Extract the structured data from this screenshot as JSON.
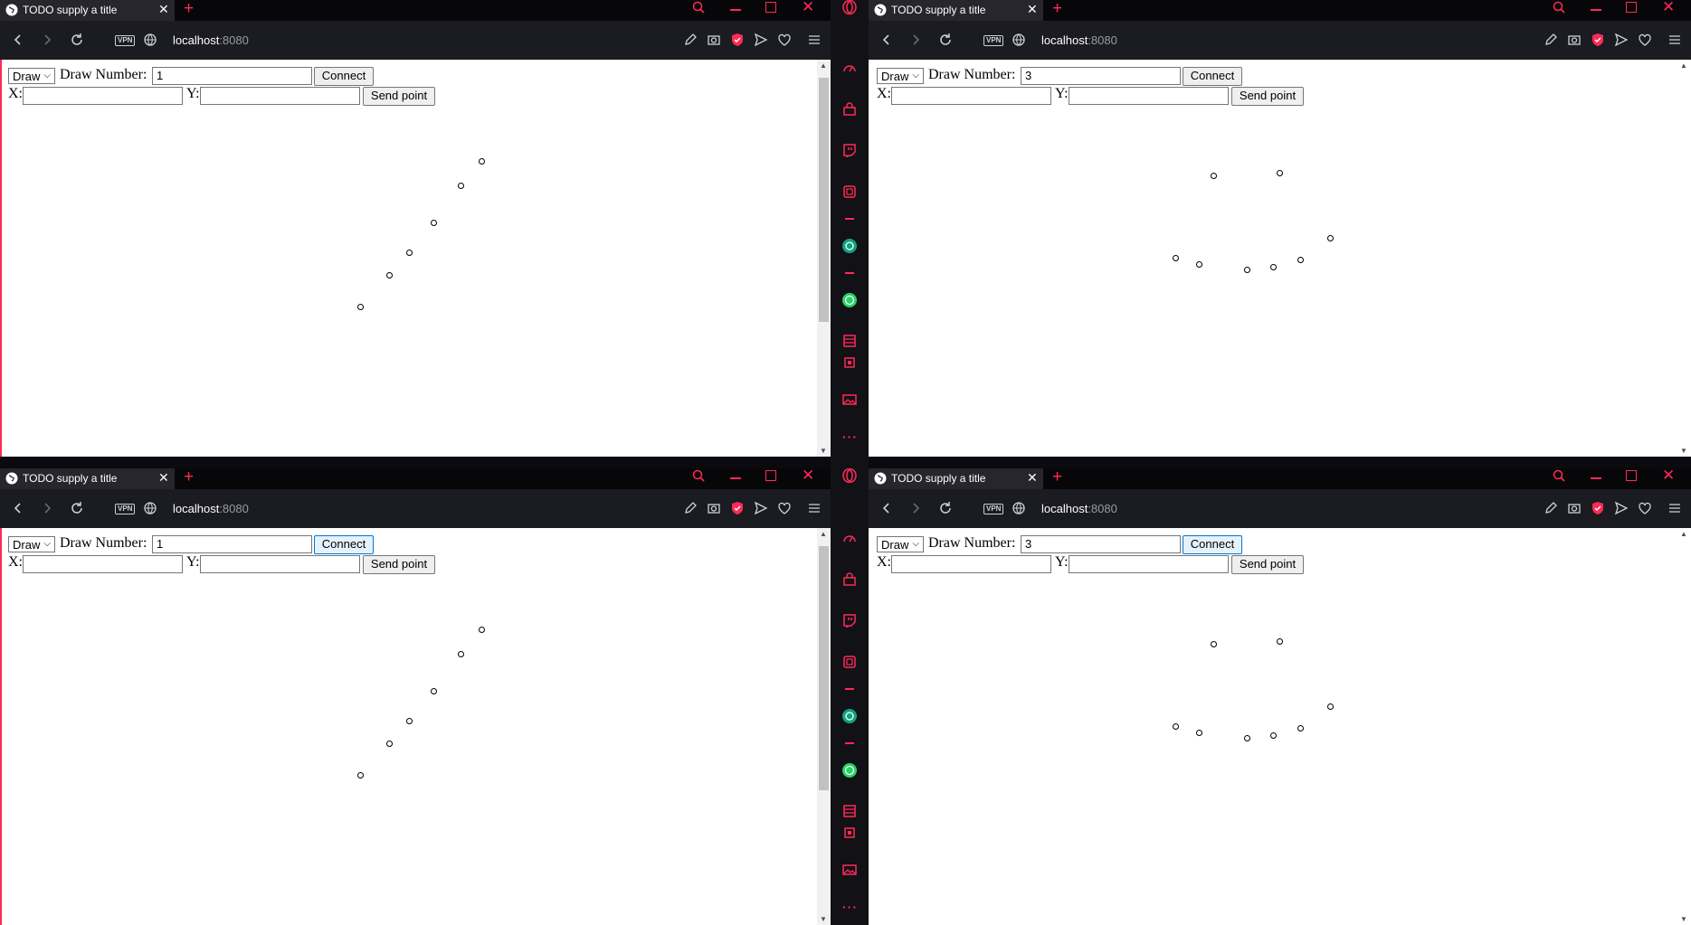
{
  "windows": [
    {
      "tab_title": "TODO supply a title",
      "url_host": "localhost",
      "url_port": ":8080",
      "mode_value": "Draw",
      "draw_number_label": "Draw Number:",
      "draw_number_value": "1",
      "connect_label": "Connect",
      "x_label": "X:",
      "y_label": "Y:",
      "send_label": "Send point",
      "connect_focused": false
    },
    {
      "tab_title": "TODO supply a title",
      "url_host": "localhost",
      "url_port": ":8080",
      "mode_value": "Draw",
      "draw_number_label": "Draw Number:",
      "draw_number_value": "3",
      "connect_label": "Connect",
      "x_label": "X:",
      "y_label": "Y:",
      "send_label": "Send point",
      "connect_focused": false
    },
    {
      "tab_title": "TODO supply a title",
      "url_host": "localhost",
      "url_port": ":8080",
      "mode_value": "Draw",
      "draw_number_label": "Draw Number:",
      "draw_number_value": "1",
      "connect_label": "Connect",
      "x_label": "X:",
      "y_label": "Y:",
      "send_label": "Send point",
      "connect_focused": true
    },
    {
      "tab_title": "TODO supply a title",
      "url_host": "localhost",
      "url_port": ":8080",
      "mode_value": "Draw",
      "draw_number_label": "Draw Number:",
      "draw_number_value": "3",
      "connect_label": "Connect",
      "x_label": "X:",
      "y_label": "Y:",
      "send_label": "Send point",
      "connect_focused": true
    }
  ],
  "colors": {
    "accent": "#ff2a55",
    "tabbar": "#07070a",
    "addressbar": "#1b1b22",
    "sidebar": "#111116",
    "whatsapp": "#25d366",
    "chatgpt": "#10a37f"
  },
  "sidebar_icons": [
    "opera-logo-icon",
    "speed-dial-icon",
    "shopping-bag-icon",
    "twitch-icon",
    "aria-icon",
    "chatgpt-icon",
    "whatsapp-icon",
    "tabs-icon",
    "chip-icon",
    "gallery-icon",
    "more-icon"
  ]
}
